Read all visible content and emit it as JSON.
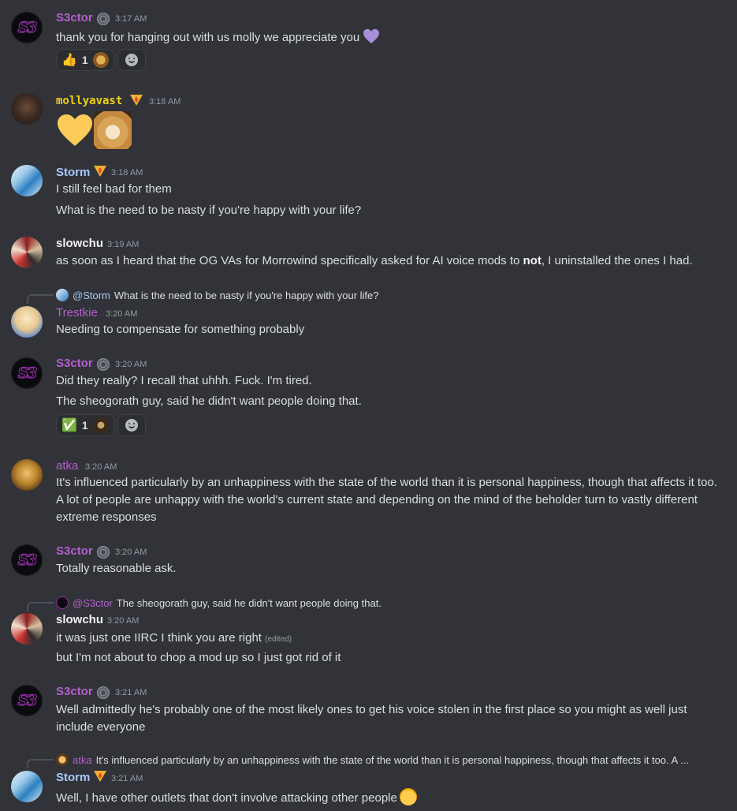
{
  "colors": {
    "background": "#313338",
    "s3ctor": "#b45fcf",
    "molly": "#f0d018",
    "storm": "#a8c7fa",
    "slowchu": "#f2f3f5",
    "trestkie": "#b45fcf",
    "atka": "#b45fcf",
    "text": "#dbdee1",
    "muted": "#949ba4"
  },
  "messages": [
    {
      "id": "m1",
      "author": "S3ctor",
      "avatar": "s3ctor-avatar",
      "badge": "gear-icon",
      "time": "3:17 AM",
      "lines": [
        "thank you for hanging out with us molly we appreciate you"
      ],
      "inline_emoji": "purple-heart-icon",
      "reactions": [
        {
          "emoji": "👍",
          "count": "1"
        }
      ]
    },
    {
      "id": "m2",
      "author": "mollyavast",
      "avatar": "molly-avatar",
      "badge": "fire-badge-icon",
      "time": "3:18 AM",
      "emojis": [
        "yellow-heart-icon",
        "doge-emoji-icon"
      ]
    },
    {
      "id": "m3",
      "author": "Storm",
      "avatar": "storm-avatar",
      "badge": "fire-badge-icon",
      "time": "3:18 AM",
      "lines": [
        "I still feel bad for them",
        "What is the need to be nasty if you're happy with your life?"
      ]
    },
    {
      "id": "m4",
      "author": "slowchu",
      "avatar": "slowchu-avatar",
      "time": "3:19 AM",
      "line_before_bold": "as soon as I heard that the OG VAs for Morrowind specifically asked for AI voice mods to ",
      "bold": "not",
      "line_after_bold": ", I uninstalled the ones I had."
    },
    {
      "id": "m5",
      "reply_to": {
        "name": "@Storm",
        "text": "What is the need to be nasty if you're happy with your life?"
      },
      "author": "Trestkie",
      "avatar": "trestkie-avatar",
      "time": "3:20 AM",
      "lines": [
        "Needing to compensate for something probably"
      ]
    },
    {
      "id": "m6",
      "author": "S3ctor",
      "avatar": "s3ctor-avatar",
      "badge": "gear-icon",
      "time": "3:20 AM",
      "lines": [
        "Did they really? I recall that uhhh. Fuck. I'm tired.",
        "The sheogorath guy, said he didn't want people doing that."
      ],
      "reactions": [
        {
          "emoji": "✅",
          "count": "1"
        }
      ]
    },
    {
      "id": "m7",
      "author": "atka",
      "avatar": "atka-avatar",
      "time": "3:20 AM",
      "lines": [
        "It's influenced particularly by an unhappiness with the state of the world than it is personal happiness, though that affects it too. A lot of people are unhappy with the world's current state and depending on the mind of the beholder turn to vastly different extreme responses"
      ]
    },
    {
      "id": "m8",
      "author": "S3ctor",
      "avatar": "s3ctor-avatar",
      "badge": "gear-icon",
      "time": "3:20 AM",
      "lines": [
        "Totally reasonable ask."
      ]
    },
    {
      "id": "m9",
      "reply_to": {
        "name": "@S3ctor",
        "text": "The sheogorath guy, said he didn't want people doing that."
      },
      "author": "slowchu",
      "avatar": "slowchu-avatar",
      "time": "3:20 AM",
      "lines": [
        "it was just one IIRC I think you are right",
        "but I'm not about to chop a mod up so I just got rid of it"
      ],
      "edited": "(edited)"
    },
    {
      "id": "m10",
      "author": "S3ctor",
      "avatar": "s3ctor-avatar",
      "badge": "gear-icon",
      "time": "3:21 AM",
      "lines": [
        "Well admittedly he's probably one of the most likely ones to get his voice stolen in the first place so you might as well just include everyone"
      ]
    },
    {
      "id": "m11",
      "reply_to": {
        "name": "atka",
        "text": "It's influenced particularly by an unhappiness with the state of the world than it is personal happiness, though that affects it too. A ..."
      },
      "author": "Storm",
      "avatar": "storm-avatar",
      "badge": "fire-badge-icon",
      "time": "3:21 AM",
      "lines": [
        "Well, I have other outlets that don't involve attacking other people"
      ],
      "inline_emoji": "sweat-smile-emoji-icon"
    }
  ]
}
